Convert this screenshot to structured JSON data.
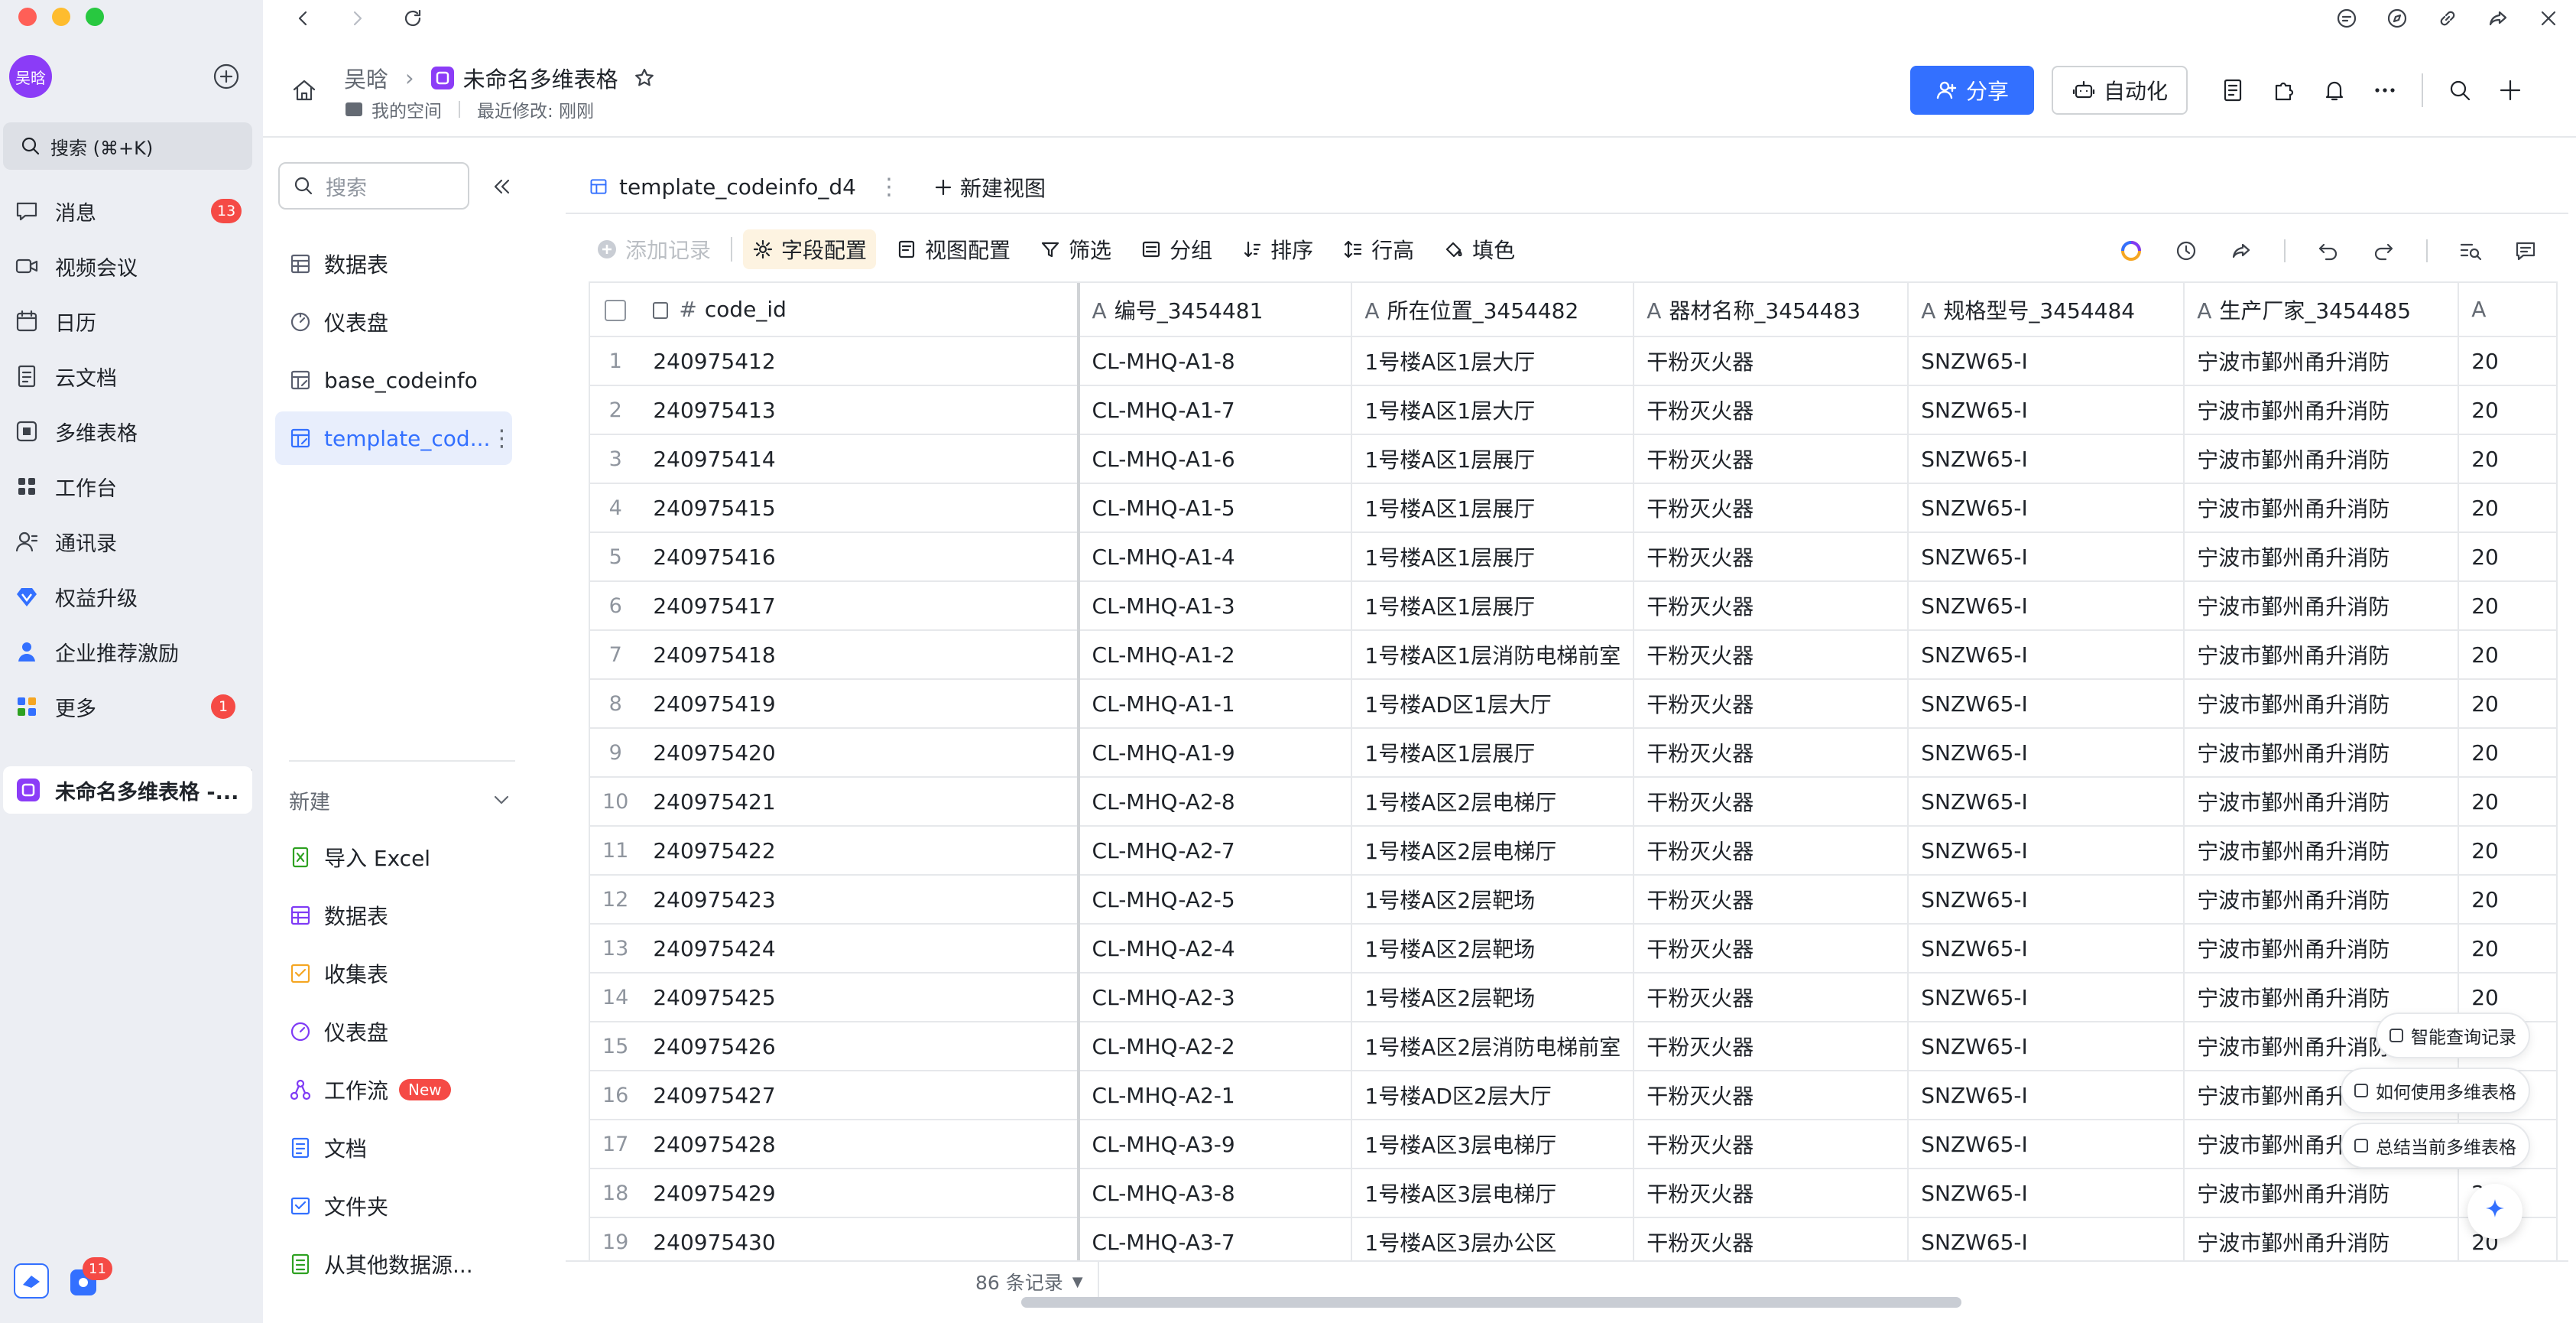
{
  "window": {
    "traffic": [
      "#ff5f57",
      "#febc2e",
      "#28c840"
    ]
  },
  "appbar": {
    "avatar_text": "吴晗",
    "search_placeholder": "搜索 (⌘+K)",
    "items": [
      {
        "label": "消息",
        "icon": "message-icon",
        "badge": "13"
      },
      {
        "label": "视频会议",
        "icon": "video-icon",
        "badge": ""
      },
      {
        "label": "日历",
        "icon": "calendar-icon",
        "badge": ""
      },
      {
        "label": "云文档",
        "icon": "cloud-doc-icon",
        "badge": ""
      },
      {
        "label": "多维表格",
        "icon": "bitable-icon",
        "badge": ""
      },
      {
        "label": "工作台",
        "icon": "workplace-icon",
        "badge": ""
      },
      {
        "label": "通讯录",
        "icon": "contacts-icon",
        "badge": ""
      },
      {
        "label": "权益升级",
        "icon": "diamond-icon",
        "badge": ""
      },
      {
        "label": "企业推荐激励",
        "icon": "referral-icon",
        "badge": ""
      },
      {
        "label": "更多",
        "icon": "more-grid-icon",
        "badge": "1"
      }
    ],
    "current_doc": "未命名多维表格 -...",
    "bottom_badge": "11"
  },
  "header": {
    "breadcrumb_user": "吴晗",
    "doc_title": "未命名多维表格",
    "location": "我的空间",
    "last_modified": "最近修改: 刚刚",
    "share_label": "分享",
    "automation_label": "自动化"
  },
  "docside": {
    "search_placeholder": "搜索",
    "tree": [
      {
        "label": "数据表",
        "icon": "table-icon"
      },
      {
        "label": "仪表盘",
        "icon": "dashboard-icon"
      },
      {
        "label": "base_codeinfo",
        "icon": "table-edit-icon"
      },
      {
        "label": "template_cod...",
        "icon": "table-edit-icon"
      }
    ],
    "new_label": "新建",
    "new_items": [
      {
        "label": "导入 Excel",
        "icon": "excel-icon",
        "color": "#2ea121"
      },
      {
        "label": "数据表",
        "icon": "table-icon",
        "color": "#7f3bf5"
      },
      {
        "label": "收集表",
        "icon": "form-icon",
        "color": "#f5a623"
      },
      {
        "label": "仪表盘",
        "icon": "dashboard-icon",
        "color": "#7f3bf5"
      },
      {
        "label": "工作流",
        "icon": "workflow-icon",
        "color": "#7f3bf5",
        "badge": "New"
      },
      {
        "label": "文档",
        "icon": "doc-icon",
        "color": "#3370ff"
      },
      {
        "label": "文件夹",
        "icon": "folder-icon",
        "color": "#3370ff"
      },
      {
        "label": "从其他数据源...",
        "icon": "datasource-icon",
        "color": "#2ea121"
      }
    ]
  },
  "view": {
    "tab_label": "template_codeinfo_d4",
    "new_view_label": "新建视图",
    "toolbar": {
      "add_record": "添加记录",
      "field_config": "字段配置",
      "view_config": "视图配置",
      "filter": "筛选",
      "group": "分组",
      "sort": "排序",
      "row_height": "行高",
      "fill": "填色"
    }
  },
  "table": {
    "columns": [
      "code_id",
      "编号_3454481",
      "所在位置_3454482",
      "器材名称_3454483",
      "规格型号_3454484",
      "生产厂家_3454485"
    ],
    "rows": [
      [
        "1",
        "240975412",
        "CL-MHQ-A1-8",
        "1号楼A区1层大厅",
        "干粉灭火器",
        "SNZW65-I",
        "宁波市鄞州甬升消防",
        "20"
      ],
      [
        "2",
        "240975413",
        "CL-MHQ-A1-7",
        "1号楼A区1层大厅",
        "干粉灭火器",
        "SNZW65-I",
        "宁波市鄞州甬升消防",
        "20"
      ],
      [
        "3",
        "240975414",
        "CL-MHQ-A1-6",
        "1号楼A区1层展厅",
        "干粉灭火器",
        "SNZW65-I",
        "宁波市鄞州甬升消防",
        "20"
      ],
      [
        "4",
        "240975415",
        "CL-MHQ-A1-5",
        "1号楼A区1层展厅",
        "干粉灭火器",
        "SNZW65-I",
        "宁波市鄞州甬升消防",
        "20"
      ],
      [
        "5",
        "240975416",
        "CL-MHQ-A1-4",
        "1号楼A区1层展厅",
        "干粉灭火器",
        "SNZW65-I",
        "宁波市鄞州甬升消防",
        "20"
      ],
      [
        "6",
        "240975417",
        "CL-MHQ-A1-3",
        "1号楼A区1层展厅",
        "干粉灭火器",
        "SNZW65-I",
        "宁波市鄞州甬升消防",
        "20"
      ],
      [
        "7",
        "240975418",
        "CL-MHQ-A1-2",
        "1号楼A区1层消防电梯前室",
        "干粉灭火器",
        "SNZW65-I",
        "宁波市鄞州甬升消防",
        "20"
      ],
      [
        "8",
        "240975419",
        "CL-MHQ-A1-1",
        "1号楼AD区1层大厅",
        "干粉灭火器",
        "SNZW65-I",
        "宁波市鄞州甬升消防",
        "20"
      ],
      [
        "9",
        "240975420",
        "CL-MHQ-A1-9",
        "1号楼A区1层展厅",
        "干粉灭火器",
        "SNZW65-I",
        "宁波市鄞州甬升消防",
        "20"
      ],
      [
        "10",
        "240975421",
        "CL-MHQ-A2-8",
        "1号楼A区2层电梯厅",
        "干粉灭火器",
        "SNZW65-I",
        "宁波市鄞州甬升消防",
        "20"
      ],
      [
        "11",
        "240975422",
        "CL-MHQ-A2-7",
        "1号楼A区2层电梯厅",
        "干粉灭火器",
        "SNZW65-I",
        "宁波市鄞州甬升消防",
        "20"
      ],
      [
        "12",
        "240975423",
        "CL-MHQ-A2-5",
        "1号楼A区2层靶场",
        "干粉灭火器",
        "SNZW65-I",
        "宁波市鄞州甬升消防",
        "20"
      ],
      [
        "13",
        "240975424",
        "CL-MHQ-A2-4",
        "1号楼A区2层靶场",
        "干粉灭火器",
        "SNZW65-I",
        "宁波市鄞州甬升消防",
        "20"
      ],
      [
        "14",
        "240975425",
        "CL-MHQ-A2-3",
        "1号楼A区2层靶场",
        "干粉灭火器",
        "SNZW65-I",
        "宁波市鄞州甬升消防",
        "20"
      ],
      [
        "15",
        "240975426",
        "CL-MHQ-A2-2",
        "1号楼A区2层消防电梯前室",
        "干粉灭火器",
        "SNZW65-I",
        "宁波市鄞州甬升消防",
        "20"
      ],
      [
        "16",
        "240975427",
        "CL-MHQ-A2-1",
        "1号楼AD区2层大厅",
        "干粉灭火器",
        "SNZW65-I",
        "宁波市鄞州甬升消防",
        "20"
      ],
      [
        "17",
        "240975428",
        "CL-MHQ-A3-9",
        "1号楼A区3层电梯厅",
        "干粉灭火器",
        "SNZW65-I",
        "宁波市鄞州甬升消防",
        "20"
      ],
      [
        "18",
        "240975429",
        "CL-MHQ-A3-8",
        "1号楼A区3层电梯厅",
        "干粉灭火器",
        "SNZW65-I",
        "宁波市鄞州甬升消防",
        "20"
      ],
      [
        "19",
        "240975430",
        "CL-MHQ-A3-7",
        "1号楼A区3层办公区",
        "干粉灭火器",
        "SNZW65-I",
        "宁波市鄞州甬升消防",
        "20"
      ]
    ],
    "record_count": "86 条记录"
  },
  "assistant": {
    "items": [
      "智能查询记录",
      "如何使用多维表格",
      "总结当前多维表格"
    ]
  },
  "colors": {
    "accent": "#3370ff",
    "danger": "#f54a45",
    "purple": "#7f3bf5",
    "selected_bg": "#e8eefc"
  }
}
